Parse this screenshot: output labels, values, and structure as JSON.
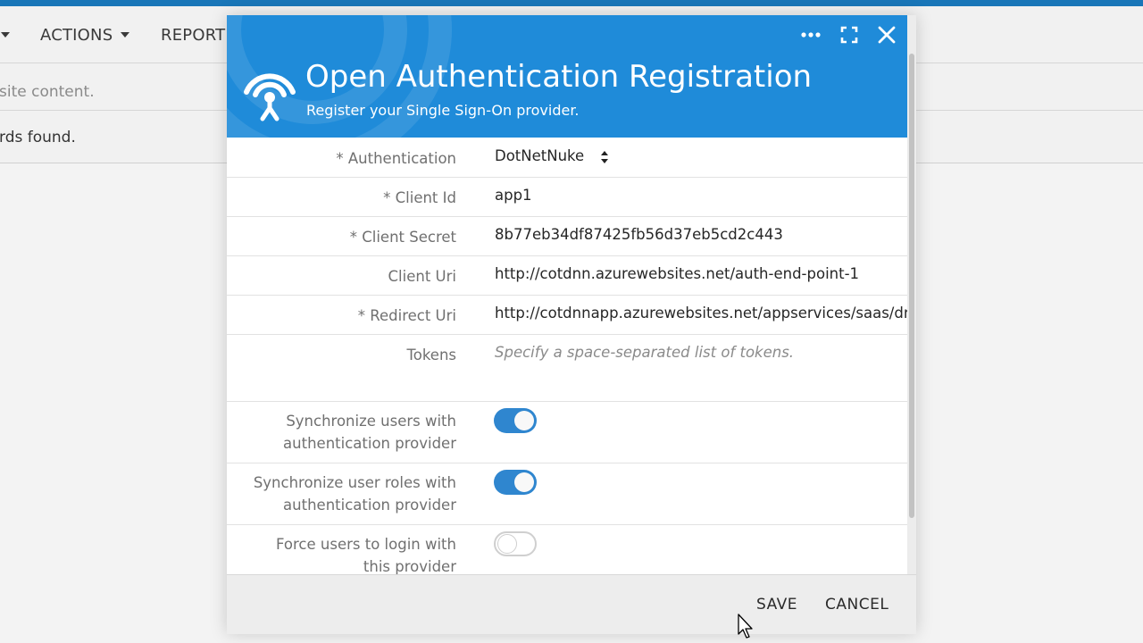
{
  "background": {
    "menu": [
      {
        "label": ""
      },
      {
        "label": "ACTIONS"
      },
      {
        "label": "REPORT"
      }
    ],
    "row1_text": "site content.",
    "row2_text": "rds found."
  },
  "dialog": {
    "title": "Open Authentication Registration",
    "subtitle": "Register your Single Sign-On provider.",
    "header_icons": [
      "more-icon",
      "expand-icon",
      "close-icon"
    ],
    "fields": [
      {
        "label": "* Authentication",
        "value": "DotNetNuke"
      },
      {
        "label": "* Client Id",
        "value": "app1"
      },
      {
        "label": "* Client Secret",
        "value": "8b77eb34df87425fb56d37eb5cd2c443"
      },
      {
        "label": "Client Uri",
        "value": "http://cotdnn.azurewebsites.net/auth-end-point-1"
      },
      {
        "label": "* Redirect Uri",
        "value": "http://cotdnnapp.azurewebsites.net/appservices/saas/dr"
      },
      {
        "label": "Tokens",
        "placeholder": "Specify a space-separated list of tokens."
      }
    ],
    "toggles": [
      {
        "label_line1": "Synchronize users with",
        "label_line2": "authentication provider",
        "on": true
      },
      {
        "label_line1": "Synchronize user roles with",
        "label_line2": "authentication provider",
        "on": true
      },
      {
        "label_line1": "Force users to login with",
        "label_line2": "this provider",
        "on": false
      }
    ],
    "footer": {
      "save": "SAVE",
      "cancel": "CANCEL"
    }
  },
  "colors": {
    "header": "#1f8bd9",
    "toggle_on": "#2f86cf",
    "topbar": "#1976b8"
  }
}
